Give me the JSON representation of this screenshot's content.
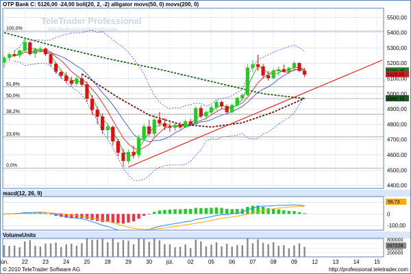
{
  "header": {
    "title": "OTP Bank C: 5126,00 -24,00 boll(20, 2, -2) alligator movs(50, 0) movs(200, 0)",
    "watermark_title": "TeleTrader Professional",
    "watermark_url": "http://professional.teletrader.com"
  },
  "footer": {
    "copyright": "© 2010 TeleTrader Software AG",
    "url": "http://professional.teletrader.com"
  },
  "colors": {
    "bull": "#22cc22",
    "bear": "#dd1111",
    "boll": "#3344ee",
    "sma50": "#116611",
    "sma200": "#661111",
    "trend": "#ee2222",
    "macd": "#2288ff",
    "signal": "#ffaa00",
    "volume": "#888888",
    "panel_title_bg": "#d8e6f8",
    "border": "#5b7fb6"
  },
  "chart_data": [
    {
      "type": "candlestick",
      "title": "OTP Bank C: 5126,00 -24,00 boll(20, 2, -2) alligator movs(50, 0) movs(200, 0)",
      "yticks": [
        4400,
        4500,
        4600,
        4700,
        4800,
        4900,
        5000,
        5100,
        5200,
        5300,
        5400,
        5500
      ],
      "ytick_labels": [
        "4400,00",
        "4500,00",
        "4600,00",
        "4700,00",
        "4800,00",
        "4900,00",
        "5000,00",
        "5100,00",
        "5200,00",
        "5300,00",
        "5400,00",
        "5500,00"
      ],
      "ylim": [
        4380,
        5560
      ],
      "xlim": [
        0,
        59
      ],
      "xticks": [
        {
          "x": 0,
          "label": "jún."
        },
        {
          "x": 4,
          "label": "22"
        },
        {
          "x": 8,
          "label": "23"
        },
        {
          "x": 12,
          "label": "24"
        },
        {
          "x": 16,
          "label": "25"
        },
        {
          "x": 20,
          "label": "28"
        },
        {
          "x": 24,
          "label": "29"
        },
        {
          "x": 28,
          "label": "30"
        },
        {
          "x": 32,
          "label": "júl."
        },
        {
          "x": 36,
          "label": "02"
        },
        {
          "x": 40,
          "label": "05"
        },
        {
          "x": 44,
          "label": "06"
        },
        {
          "x": 48,
          "label": "07"
        },
        {
          "x": 52,
          "label": "08"
        },
        {
          "x": 56,
          "label": "09"
        },
        {
          "x": 60,
          "label": "12"
        },
        {
          "x": 64,
          "label": "13"
        },
        {
          "x": 68,
          "label": "14"
        },
        {
          "x": 72,
          "label": "15"
        }
      ],
      "fibonacci": [
        {
          "label": "100,0%",
          "value": 5410
        },
        {
          "label": "61,8%",
          "value": 5045
        },
        {
          "label": "50,0%",
          "value": 4968
        },
        {
          "label": "38,2%",
          "value": 4865
        },
        {
          "label": "23,6%",
          "value": 4717
        },
        {
          "label": "0,0%",
          "value": 4512
        }
      ],
      "last_price_badges": [
        {
          "label": "5150,76",
          "value": 5150,
          "color": "#2a7a2a"
        },
        {
          "label": "5126,00",
          "value": 5126,
          "color": "#cc2222"
        },
        {
          "label": "4968,15",
          "value": 4968,
          "color": "#225522"
        }
      ],
      "candles": [
        [
          5205,
          5250,
          5170,
          5235
        ],
        [
          5235,
          5270,
          5215,
          5258
        ],
        [
          5258,
          5282,
          5240,
          5250
        ],
        [
          5252,
          5290,
          5235,
          5282
        ],
        [
          5282,
          5370,
          5270,
          5338
        ],
        [
          5335,
          5345,
          5250,
          5260
        ],
        [
          5262,
          5300,
          5235,
          5290
        ],
        [
          5292,
          5310,
          5270,
          5295
        ],
        [
          5295,
          5302,
          5248,
          5260
        ],
        [
          5258,
          5266,
          5180,
          5198
        ],
        [
          5196,
          5208,
          5130,
          5145
        ],
        [
          5142,
          5158,
          5098,
          5118
        ],
        [
          5118,
          5140,
          5068,
          5085
        ],
        [
          5086,
          5112,
          5050,
          5066
        ],
        [
          5066,
          5120,
          5050,
          5100
        ],
        [
          5100,
          5125,
          5045,
          5060
        ],
        [
          5060,
          5080,
          4945,
          4968
        ],
        [
          4965,
          4990,
          4860,
          4895
        ],
        [
          4895,
          4915,
          4800,
          4850
        ],
        [
          4850,
          4872,
          4735,
          4762
        ],
        [
          4762,
          4800,
          4700,
          4785
        ],
        [
          4782,
          4792,
          4660,
          4688
        ],
        [
          4688,
          4702,
          4590,
          4615
        ],
        [
          4612,
          4640,
          4520,
          4560
        ],
        [
          4558,
          4635,
          4540,
          4618
        ],
        [
          4618,
          4660,
          4575,
          4598
        ],
        [
          4598,
          4730,
          4580,
          4708
        ],
        [
          4705,
          4800,
          4690,
          4785
        ],
        [
          4785,
          4830,
          4720,
          4738
        ],
        [
          4738,
          4862,
          4720,
          4830
        ],
        [
          4830,
          4880,
          4790,
          4805
        ],
        [
          4805,
          4840,
          4762,
          4785
        ],
        [
          4785,
          4810,
          4750,
          4778
        ],
        [
          4778,
          4812,
          4755,
          4795
        ],
        [
          4795,
          4815,
          4768,
          4780
        ],
        [
          4780,
          4830,
          4775,
          4818
        ],
        [
          4818,
          4835,
          4792,
          4802
        ],
        [
          4802,
          4918,
          4798,
          4905
        ],
        [
          4905,
          4922,
          4838,
          4852
        ],
        [
          4852,
          4890,
          4830,
          4878
        ],
        [
          4878,
          4925,
          4865,
          4910
        ],
        [
          4910,
          4960,
          4892,
          4945
        ],
        [
          4945,
          4955,
          4900,
          4918
        ],
        [
          4918,
          4930,
          4865,
          4880
        ],
        [
          4880,
          4935,
          4870,
          4925
        ],
        [
          4925,
          4980,
          4915,
          4972
        ],
        [
          4972,
          5000,
          4955,
          4992
        ],
        [
          4992,
          5195,
          4985,
          5170
        ],
        [
          5170,
          5220,
          5140,
          5192
        ],
        [
          5192,
          5255,
          5150,
          5178
        ],
        [
          5178,
          5195,
          5098,
          5120
        ],
        [
          5120,
          5150,
          5085,
          5102
        ],
        [
          5102,
          5165,
          5095,
          5150
        ],
        [
          5150,
          5178,
          5118,
          5160
        ],
        [
          5160,
          5190,
          5140,
          5145
        ],
        [
          5145,
          5175,
          5130,
          5168
        ],
        [
          5168,
          5210,
          5150,
          5200
        ],
        [
          5200,
          5205,
          5140,
          5150
        ],
        [
          5150,
          5168,
          5110,
          5126
        ]
      ]
    },
    {
      "type": "bar",
      "title": "macd(12, 26, 9)",
      "yticks": [
        -100,
        0,
        100
      ],
      "ytick_labels": [
        "-100,00",
        "0",
        "100,00"
      ],
      "ylim": [
        -140,
        150
      ],
      "badge": "56,73",
      "series": [
        {
          "name": "macd(12, 26, 9)"
        }
      ]
    },
    {
      "type": "bar",
      "title": "VolumeUnits",
      "yticks": [
        200000,
        400000,
        600000,
        800000
      ],
      "ytick_labels": [
        "200000",
        "400000",
        "600000",
        "800000"
      ],
      "ylim": [
        0,
        850000
      ],
      "badge": "337228"
    }
  ]
}
